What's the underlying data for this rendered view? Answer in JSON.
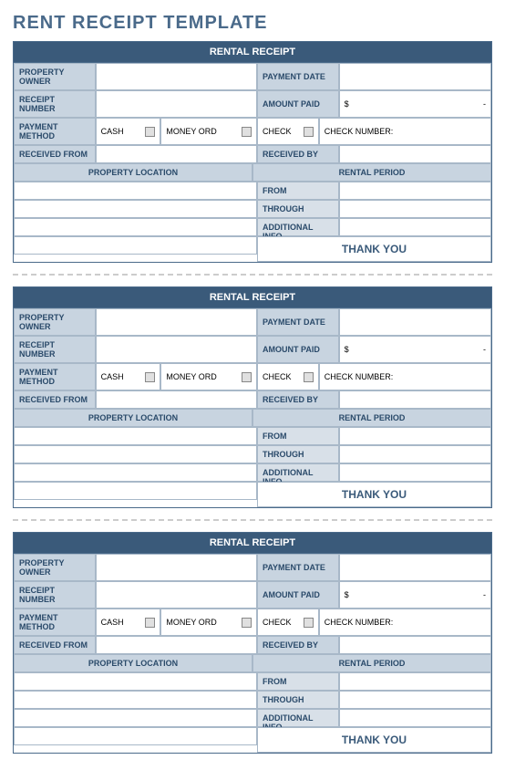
{
  "title": "RENT RECEIPT TEMPLATE",
  "receipt": {
    "header": "RENTAL RECEIPT",
    "labels": {
      "propertyOwner": "PROPERTY OWNER",
      "paymentDate": "PAYMENT DATE",
      "receiptNumber": "RECEIPT NUMBER",
      "amountPaid": "AMOUNT PAID",
      "paymentMethod": "PAYMENT METHOD",
      "receivedFrom": "RECEIVED FROM",
      "receivedBy": "RECEIVED BY",
      "propertyLocation": "PROPERTY LOCATION",
      "rentalPeriod": "RENTAL PERIOD",
      "from": "FROM",
      "through": "THROUGH",
      "additionalInfo": "ADDITIONAL INFO",
      "thankYou": "THANK YOU",
      "cash": "CASH",
      "moneyOrd": "MONEY ORD",
      "check": "CHECK",
      "checkNumber": "CHECK NUMBER:"
    },
    "values": {
      "currencySymbol": "$",
      "amountDash": "-"
    }
  }
}
